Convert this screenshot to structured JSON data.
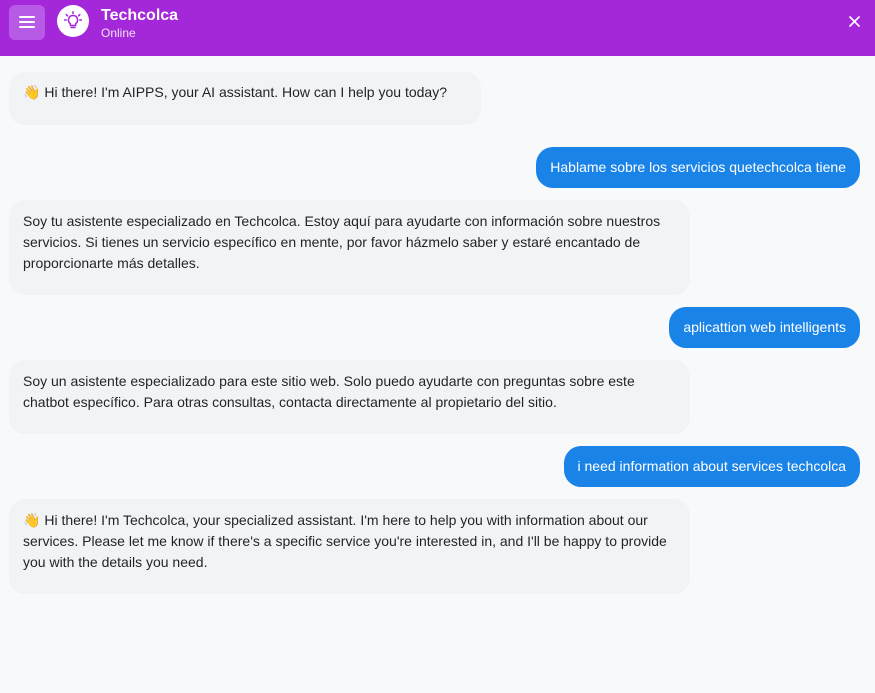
{
  "header": {
    "title": "Techcolca",
    "status": "Online",
    "brand_color": "#a427d9",
    "menu_icon": "hamburger-menu-icon",
    "avatar_icon": "lightbulb-icon",
    "close_icon": "close-icon"
  },
  "messages": [
    {
      "role": "bot",
      "emoji": "👋",
      "text": " Hi there! I'm AIPPS, your AI assistant. How can I help you today?"
    },
    {
      "role": "user",
      "text": "Hablame sobre los servicios quetechcolca tiene"
    },
    {
      "role": "bot",
      "text": "Soy tu asistente especializado en Techcolca. Estoy aquí para ayudarte con información sobre nuestros servicios. Si tienes un servicio específico en mente, por favor házmelo saber y estaré encantado de proporcionarte más detalles."
    },
    {
      "role": "user",
      "text": "aplicattion web intelligents"
    },
    {
      "role": "bot",
      "text": "Soy un asistente especializado para este sitio web. Solo puedo ayudarte con preguntas sobre este chatbot específico. Para otras consultas, contacta directamente al propietario del sitio."
    },
    {
      "role": "user",
      "text": "i need information about services techcolca"
    },
    {
      "role": "bot",
      "emoji": "👋",
      "text": " Hi there! I'm Techcolca, your specialized assistant. I'm here to help you with information about our services. Please let me know if there's a specific service you're interested in, and I'll be happy to provide you with the details you need."
    }
  ],
  "colors": {
    "user_bubble": "#1a83e8",
    "bot_bubble": "#f2f3f4",
    "background": "#f8f9fb"
  }
}
